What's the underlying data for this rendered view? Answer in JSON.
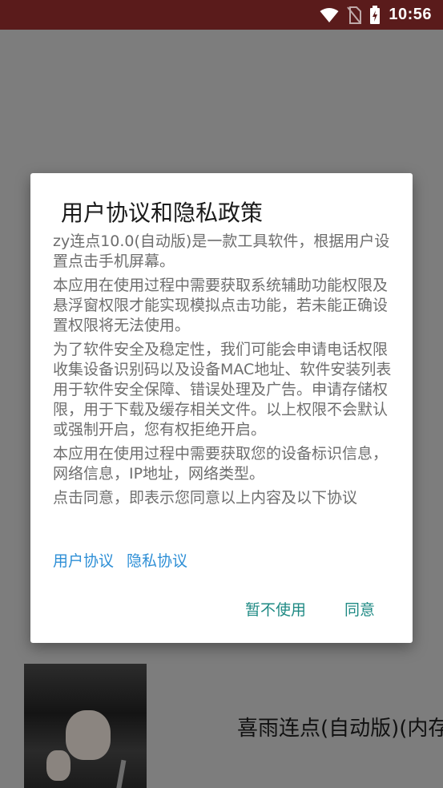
{
  "status_bar": {
    "time": "10:56"
  },
  "app": {
    "title": "喜雨连点(自动版)(内存"
  },
  "dialog": {
    "title": "用户协议和隐私政策",
    "paragraphs": [
      "zy连点10.0(自动版)是一款工具软件，根据用户设置点击手机屏幕。",
      "本应用在使用过程中需要获取系统辅助功能权限及悬浮窗权限才能实现模拟点击功能，若未能正确设置权限将无法使用。",
      "为了软件安全及稳定性，我们可能会申请电话权限收集设备识别码以及设备MAC地址、软件安装列表用于软件安全保障、错误处理及广告。申请存储权限，用于下载及缓存相关文件。以上权限不会默认或强制开启，您有权拒绝开启。",
      "本应用在使用过程中需要获取您的设备标识信息，网络信息，IP地址，网络类型。",
      "点击同意，即表示您同意以上内容及以下协议"
    ],
    "links": {
      "user_agreement": "用户协议",
      "privacy_agreement": "隐私协议"
    },
    "buttons": {
      "decline": "暂不使用",
      "agree": "同意"
    }
  }
}
